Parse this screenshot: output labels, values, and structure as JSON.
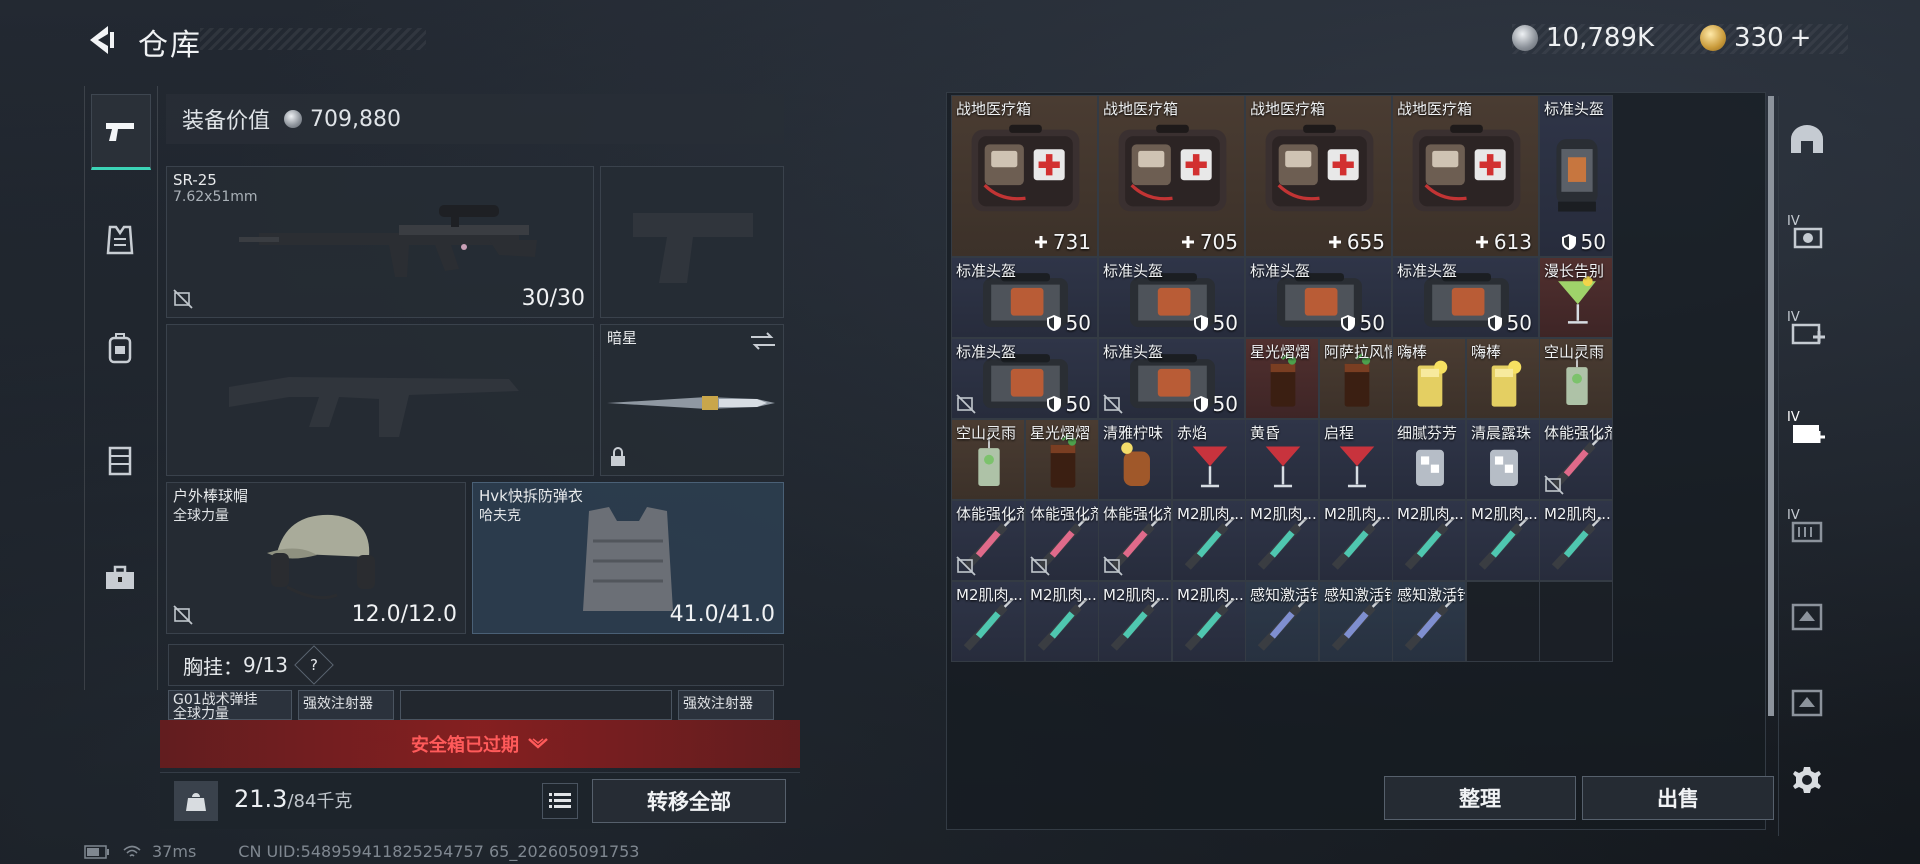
{
  "header": {
    "title": "仓库",
    "currency_silver": "10,789K",
    "currency_gold": "330",
    "currency_gold_plus": "+"
  },
  "left_nav": {
    "items": [
      "pistol-icon",
      "armor-vest-icon",
      "backpack-icon",
      "chest-rig-icon",
      "toolbox-icon"
    ]
  },
  "equipment": {
    "value_label": "装备价值",
    "value": "709,880",
    "primary": {
      "name": "SR-25",
      "caliber": "7.62x51mm",
      "durability": "30/30"
    },
    "melee": {
      "name": "暗星"
    },
    "helmet": {
      "name": "户外棒球帽",
      "sub": "全球力量",
      "durability": "12.0/12.0"
    },
    "armor": {
      "name": "Hvk快拆防弹衣",
      "sub": "哈夫克",
      "durability": "41.0/41.0"
    },
    "chest_rig_label": "胸挂：",
    "chest_rig_value": "9/13",
    "chest_rig_help": "?",
    "chest_items": [
      "G01战术弹挂",
      "全球力量",
      "强效注射器",
      "强效注射器"
    ],
    "safe_box_expired": "安全箱已过期",
    "weight_value": "21.3",
    "weight_max": "/84千克",
    "transfer_all": "转移全部"
  },
  "status": {
    "ping": "37ms",
    "uid": "CN UID:548959411825254757 65_202605091753"
  },
  "storage": {
    "sort_label": "整理",
    "sell_label": "出售",
    "cells": [
      {
        "label": "战地医疗箱",
        "count": "731",
        "icon": "medkit",
        "bg": "brown",
        "badge": "plus"
      },
      {
        "label": "战地医疗箱",
        "count": "705",
        "icon": "medkit",
        "bg": "brown",
        "badge": "plus"
      },
      {
        "label": "战地医疗箱",
        "count": "655",
        "icon": "medkit",
        "bg": "brown",
        "badge": "plus"
      },
      {
        "label": "战地医疗箱",
        "count": "613",
        "icon": "medkit",
        "bg": "brown",
        "badge": "plus"
      },
      {
        "label": "标准头盔",
        "count": "50",
        "icon": "helmet",
        "bg": "navy",
        "badge": "shield"
      },
      {
        "label": "标准头盔",
        "count": "50",
        "icon": "armorbag",
        "bg": "navy",
        "badge": "shield"
      },
      {
        "label": "标准头盔",
        "count": "50",
        "icon": "armorbag",
        "bg": "navy",
        "badge": "shield"
      },
      {
        "label": "标准头盔",
        "count": "50",
        "icon": "armorbag",
        "bg": "navy",
        "badge": "shield"
      },
      {
        "label": "标准头盔",
        "count": "50",
        "icon": "armorbag",
        "bg": "navy",
        "badge": "shield"
      },
      {
        "label": "漫长告别",
        "count": "",
        "icon": "cocktail",
        "bg": "red",
        "badge": ""
      },
      {
        "label": "标准头盔",
        "count": "50",
        "icon": "armorbag",
        "bg": "navy",
        "badge": "shield"
      },
      {
        "label": "标准头盔",
        "count": "50",
        "icon": "armorbag",
        "bg": "navy",
        "badge": "shield"
      },
      {
        "label": "星光熠熠",
        "count": "",
        "icon": "cola",
        "bg": "red",
        "badge": ""
      },
      {
        "label": "阿萨拉风情",
        "count": "",
        "icon": "cola",
        "bg": "brown",
        "badge": ""
      },
      {
        "label": "嗨棒",
        "count": "",
        "icon": "lemon",
        "bg": "brown",
        "badge": ""
      },
      {
        "label": "嗨棒",
        "count": "",
        "icon": "lemon",
        "bg": "brown",
        "badge": ""
      },
      {
        "label": "空山灵雨",
        "count": "",
        "icon": "mojito",
        "bg": "brown",
        "badge": ""
      },
      {
        "label": "空山灵雨",
        "count": "",
        "icon": "mojito",
        "bg": "brown",
        "badge": ""
      },
      {
        "label": "星光熠熠",
        "count": "",
        "icon": "cola",
        "bg": "brown",
        "badge": ""
      },
      {
        "label": "清雅柠味",
        "count": "",
        "icon": "tea",
        "bg": "navy",
        "badge": ""
      },
      {
        "label": "赤焰",
        "count": "",
        "icon": "martini",
        "bg": "navy",
        "badge": ""
      },
      {
        "label": "黄昏",
        "count": "",
        "icon": "martini",
        "bg": "navy",
        "badge": ""
      },
      {
        "label": "启程",
        "count": "",
        "icon": "martini",
        "bg": "navy",
        "badge": ""
      },
      {
        "label": "细腻芬芳",
        "count": "",
        "icon": "ice",
        "bg": "navy",
        "badge": ""
      },
      {
        "label": "清晨露珠",
        "count": "",
        "icon": "ice",
        "bg": "navy",
        "badge": ""
      },
      {
        "label": "体能强化剂",
        "count": "",
        "icon": "syringe-pink",
        "bg": "navy",
        "badge": ""
      },
      {
        "label": "体能强化剂",
        "count": "",
        "icon": "syringe-pink",
        "bg": "navy",
        "badge": ""
      },
      {
        "label": "体能强化剂",
        "count": "",
        "icon": "syringe-pink",
        "bg": "navy",
        "badge": ""
      },
      {
        "label": "体能强化剂",
        "count": "",
        "icon": "syringe-pink",
        "bg": "navy",
        "badge": ""
      },
      {
        "label": "M2肌肉...",
        "count": "",
        "icon": "syringe-teal",
        "bg": "navy",
        "badge": ""
      },
      {
        "label": "M2肌肉...",
        "count": "",
        "icon": "syringe-teal",
        "bg": "navy",
        "badge": ""
      },
      {
        "label": "M2肌肉...",
        "count": "",
        "icon": "syringe-teal",
        "bg": "navy",
        "badge": ""
      },
      {
        "label": "M2肌肉...",
        "count": "",
        "icon": "syringe-teal",
        "bg": "navy",
        "badge": ""
      },
      {
        "label": "M2肌肉...",
        "count": "",
        "icon": "syringe-teal",
        "bg": "navy",
        "badge": ""
      },
      {
        "label": "M2肌肉...",
        "count": "",
        "icon": "syringe-teal",
        "bg": "navy",
        "badge": ""
      },
      {
        "label": "M2肌肉...",
        "count": "",
        "icon": "syringe-teal",
        "bg": "navy",
        "badge": ""
      },
      {
        "label": "M2肌肉...",
        "count": "",
        "icon": "syringe-teal",
        "bg": "navy",
        "badge": ""
      },
      {
        "label": "M2肌肉...",
        "count": "",
        "icon": "syringe-teal",
        "bg": "navy",
        "badge": ""
      },
      {
        "label": "M2肌肉...",
        "count": "",
        "icon": "syringe-teal",
        "bg": "navy",
        "badge": ""
      },
      {
        "label": "感知激活针",
        "count": "",
        "icon": "syringe-blue",
        "bg": "steel",
        "badge": ""
      },
      {
        "label": "感知激活针",
        "count": "",
        "icon": "syringe-blue",
        "bg": "steel",
        "badge": ""
      },
      {
        "label": "感知激活针",
        "count": "",
        "icon": "syringe-blue",
        "bg": "steel",
        "badge": ""
      }
    ]
  },
  "right_rail": {
    "items": [
      "helmet-tier-icon",
      "ammo-box-tier-icon",
      "medkit-tier-icon",
      "medkit-plus-tier-icon",
      "container-tier-icon",
      "key-tier-icon",
      "key2-tier-icon",
      "settings-icon"
    ],
    "tier_label": "IV"
  },
  "colors": {
    "accent_teal": "#3bd3b6",
    "alert_red": "#ff5a5a"
  }
}
